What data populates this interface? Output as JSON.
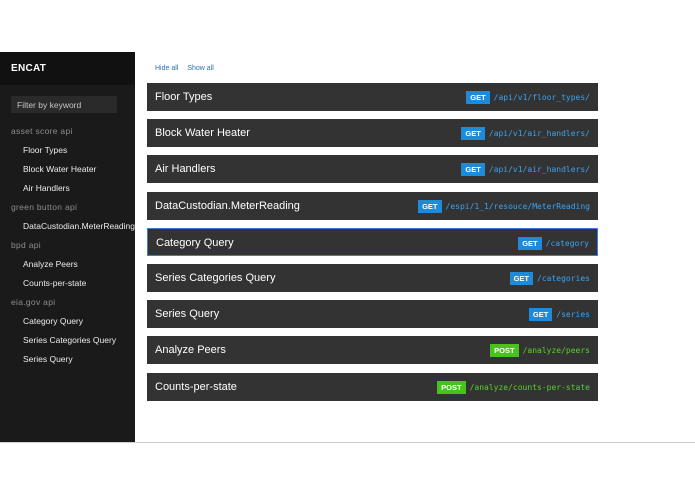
{
  "sidebar": {
    "brand": "ENCAT",
    "filter_placeholder": "Filter by keyword",
    "groups": [
      {
        "label": "asset score api",
        "items": [
          "Floor Types",
          "Block Water Heater",
          "Air Handlers"
        ]
      },
      {
        "label": "green button api",
        "items": [
          "DataCustodian.MeterReading"
        ]
      },
      {
        "label": "bpd api",
        "items": [
          "Analyze Peers",
          "Counts-per-state"
        ]
      },
      {
        "label": "eia.gov api",
        "items": [
          "Category Query",
          "Series Categories Query",
          "Series Query"
        ]
      }
    ]
  },
  "toolbar": {
    "hide_all": "Hide all",
    "show_all": "Show all"
  },
  "colors": {
    "get": "#1f8ad8",
    "post": "#48c31c",
    "get_path": "#3aa3f2",
    "post_path": "#5ad12b"
  },
  "endpoints": [
    {
      "title": "Floor Types",
      "method": "GET",
      "path": "/api/v1/floor_types/",
      "active": false
    },
    {
      "title": "Block Water Heater",
      "method": "GET",
      "path": "/api/v1/air_handlers/",
      "active": false
    },
    {
      "title": "Air Handlers",
      "method": "GET",
      "path": "/api/v1/air_handlers/",
      "active": false
    },
    {
      "title": "DataCustodian.MeterReading",
      "method": "GET",
      "path": "/espi/1_1/resouce/MeterReading",
      "active": false
    },
    {
      "title": "Category Query",
      "method": "GET",
      "path": "/category",
      "active": true
    },
    {
      "title": "Series Categories Query",
      "method": "GET",
      "path": "/categories",
      "active": false
    },
    {
      "title": "Series Query",
      "method": "GET",
      "path": "/series",
      "active": false
    },
    {
      "title": "Analyze Peers",
      "method": "POST",
      "path": "/analyze/peers",
      "active": false
    },
    {
      "title": "Counts-per-state",
      "method": "POST",
      "path": "/analyze/counts-per-state",
      "active": false
    }
  ]
}
